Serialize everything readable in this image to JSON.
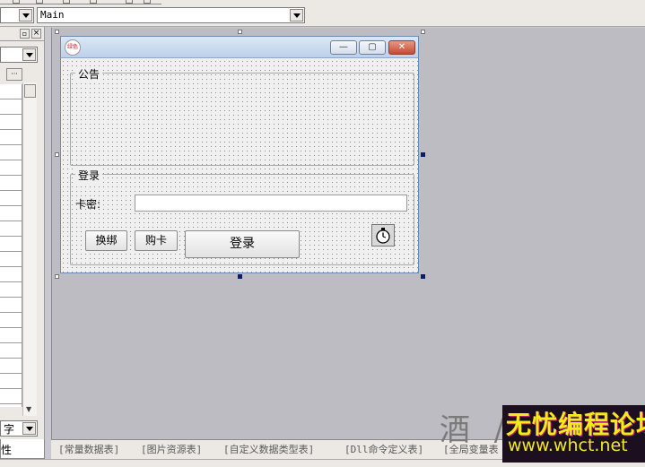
{
  "toolbar": {
    "object_combo": {
      "value": ""
    },
    "event_combo": {
      "value": "Main"
    }
  },
  "left_panel": {
    "property_combo": {
      "value": ""
    },
    "ellipsis_label": "···",
    "sort_combo": {
      "value": "字"
    },
    "tab_label": "性"
  },
  "form": {
    "icon_label": "绿色",
    "caption_buttons": {
      "minimize": "—",
      "maximize": "▢",
      "close": "✕"
    },
    "notice_group": {
      "label": "公告"
    },
    "login_group": {
      "label": "登录",
      "card_label": "卡密:",
      "card_input": {
        "value": ""
      },
      "rebind_button": "换绑",
      "buy_button": "购卡",
      "login_button": "登录",
      "timer_icon": "stopwatch-icon"
    }
  },
  "bottom_tabs": [
    "[常量数据表]",
    "[图片资源表]",
    "[自定义数据类型表]",
    "[Dll命令定义表]",
    "[全局变量表"
  ],
  "watermark": {
    "left_text": "酒 / 三",
    "title": "无忧编程论坛",
    "url": "www.whct.net"
  },
  "colors": {
    "design_surface": "#bdbcc3",
    "titlebar": "#bcd1ea",
    "selection_handle": "#0b1b6e",
    "watermark_text": "#f2ea1a"
  }
}
